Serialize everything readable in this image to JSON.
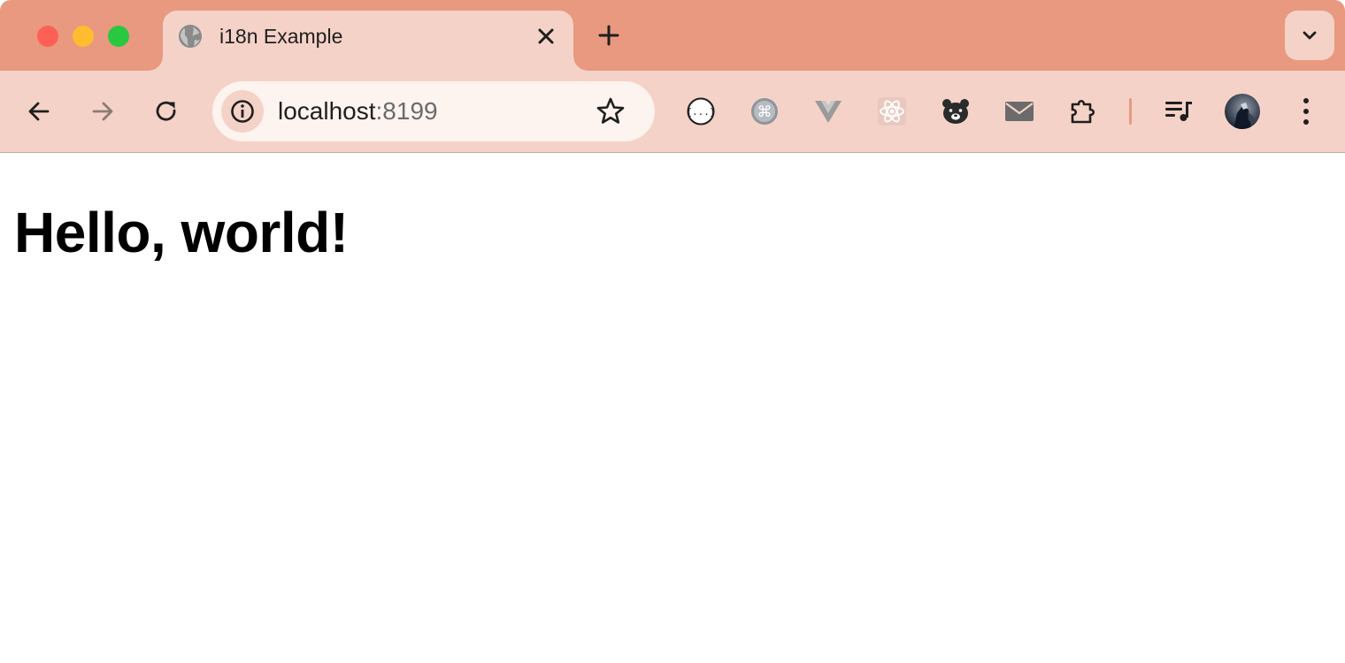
{
  "browser": {
    "tab": {
      "title": "i18n Example",
      "favicon": "globe-icon"
    },
    "omnibox": {
      "host": "localhost",
      "port": ":8199",
      "site_info_icon": "info-icon",
      "bookmark_icon": "star-icon"
    },
    "extensions": [
      "json-viewer-icon",
      "command-icon",
      "vue-devtools-icon",
      "react-devtools-icon",
      "bear-icon",
      "mail-icon",
      "puzzle-icon"
    ],
    "colors": {
      "frame": "#e8997f",
      "toolbar": "#f5d2c7",
      "omnibox": "#fdf3ef",
      "traffic_close": "#fe5f57",
      "traffic_minimize": "#febc2e",
      "traffic_maximize": "#28c840"
    }
  },
  "page": {
    "heading": "Hello, world!"
  }
}
